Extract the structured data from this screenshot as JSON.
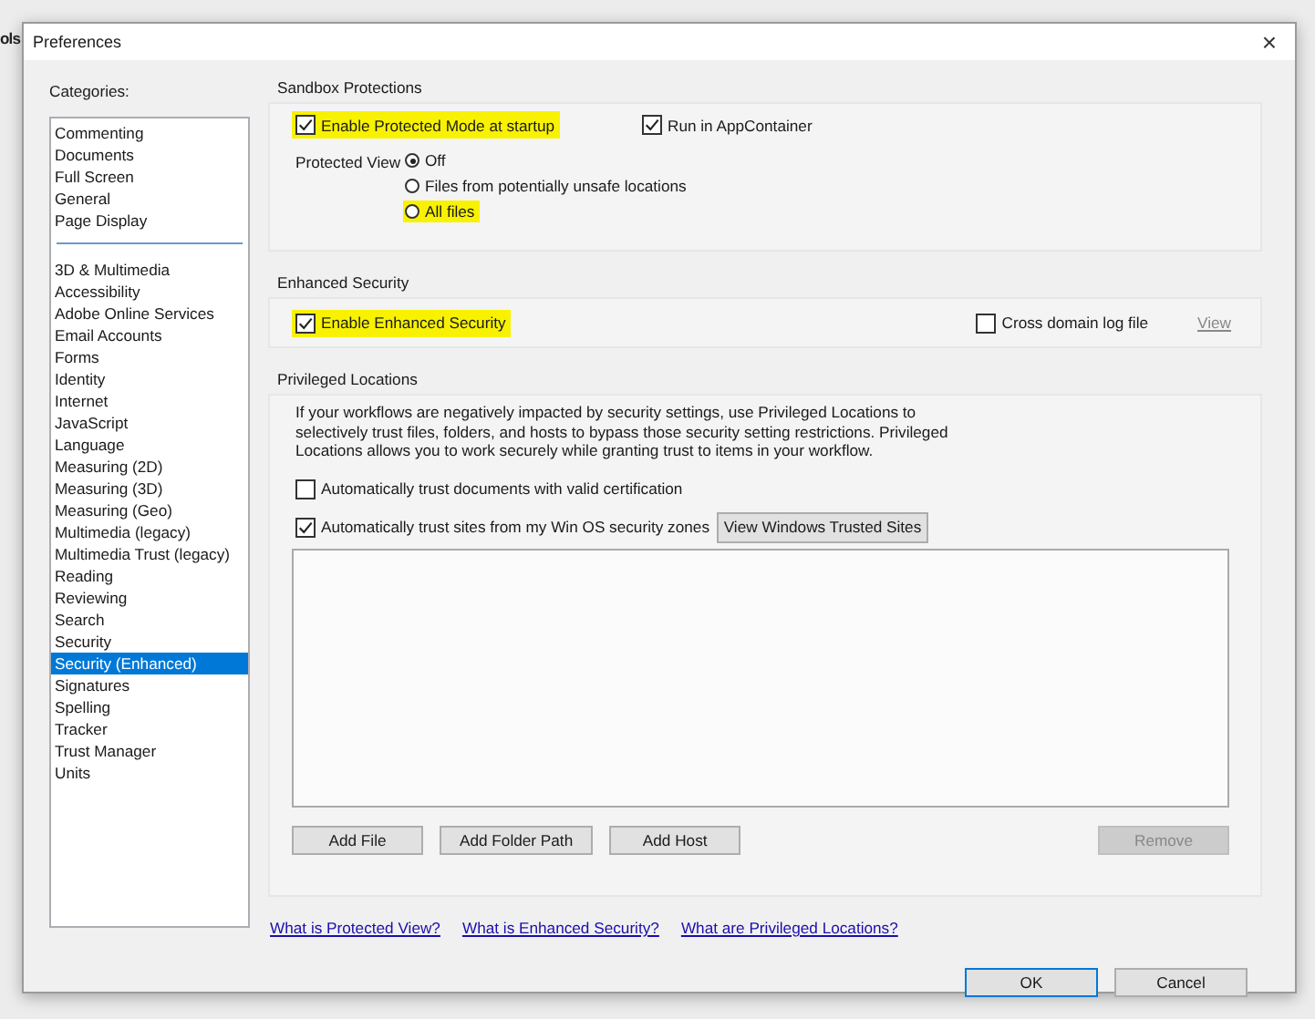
{
  "background": {
    "fragment": "ols"
  },
  "window": {
    "title": "Preferences",
    "close": "×"
  },
  "categories": {
    "label": "Categories:",
    "groups": [
      [
        {
          "label": "Commenting",
          "selected": false
        },
        {
          "label": "Documents",
          "selected": false
        },
        {
          "label": "Full Screen",
          "selected": false
        },
        {
          "label": "General",
          "selected": false
        },
        {
          "label": "Page Display",
          "selected": false
        }
      ],
      [
        {
          "label": "3D & Multimedia",
          "selected": false
        },
        {
          "label": "Accessibility",
          "selected": false
        },
        {
          "label": "Adobe Online Services",
          "selected": false
        },
        {
          "label": "Email Accounts",
          "selected": false
        },
        {
          "label": "Forms",
          "selected": false
        },
        {
          "label": "Identity",
          "selected": false
        },
        {
          "label": "Internet",
          "selected": false
        },
        {
          "label": "JavaScript",
          "selected": false
        },
        {
          "label": "Language",
          "selected": false
        },
        {
          "label": "Measuring (2D)",
          "selected": false
        },
        {
          "label": "Measuring (3D)",
          "selected": false
        },
        {
          "label": "Measuring (Geo)",
          "selected": false
        },
        {
          "label": "Multimedia (legacy)",
          "selected": false
        },
        {
          "label": "Multimedia Trust (legacy)",
          "selected": false
        },
        {
          "label": "Reading",
          "selected": false
        },
        {
          "label": "Reviewing",
          "selected": false
        },
        {
          "label": "Search",
          "selected": false
        },
        {
          "label": "Security",
          "selected": false
        },
        {
          "label": "Security (Enhanced)",
          "selected": true
        },
        {
          "label": "Signatures",
          "selected": false
        },
        {
          "label": "Spelling",
          "selected": false
        },
        {
          "label": "Tracker",
          "selected": false
        },
        {
          "label": "Trust Manager",
          "selected": false
        },
        {
          "label": "Units",
          "selected": false
        }
      ]
    ]
  },
  "sandbox": {
    "title": "Sandbox Protections",
    "protected_mode": {
      "label": "Enable Protected Mode at startup",
      "checked": true,
      "highlighted": true
    },
    "app_container": {
      "label": "Run in AppContainer",
      "checked": true,
      "highlighted": false
    },
    "protected_view": {
      "label": "Protected View",
      "options": [
        {
          "label": "Off",
          "selected": true,
          "highlighted": false
        },
        {
          "label": "Files from potentially unsafe locations",
          "selected": false,
          "highlighted": false
        },
        {
          "label": "All files",
          "selected": false,
          "highlighted": true
        }
      ]
    }
  },
  "enhanced": {
    "title": "Enhanced Security",
    "enable": {
      "label": "Enable Enhanced Security",
      "checked": true,
      "highlighted": true
    },
    "cross_domain": {
      "label": "Cross domain log file",
      "checked": false,
      "highlighted": false
    },
    "view_link": {
      "label": "View",
      "disabled": true
    }
  },
  "privileged": {
    "title": "Privileged Locations",
    "description": "If your workflows are negatively impacted by security settings, use Privileged Locations to selectively trust files, folders, and hosts to bypass those security setting restrictions. Privileged Locations allows you to work securely while granting trust to items in your workflow.",
    "trust_certified": {
      "label": "Automatically trust documents with valid certification",
      "checked": false,
      "highlighted": false
    },
    "trust_sites": {
      "label": "Automatically trust sites from my Win OS security zones",
      "checked": true,
      "highlighted": false
    },
    "view_sites_button": "View Windows Trusted Sites",
    "buttons": [
      {
        "label": "Add File",
        "disabled": false
      },
      {
        "label": "Add Folder Path",
        "disabled": false
      },
      {
        "label": "Add Host",
        "disabled": false
      },
      {
        "label": "Remove",
        "disabled": true
      }
    ]
  },
  "links": [
    "What is Protected View?",
    "What is Enhanced Security?",
    "What are Privileged Locations?"
  ],
  "footer_buttons": [
    {
      "label": "OK",
      "default": true
    },
    {
      "label": "Cancel",
      "default": false
    }
  ]
}
